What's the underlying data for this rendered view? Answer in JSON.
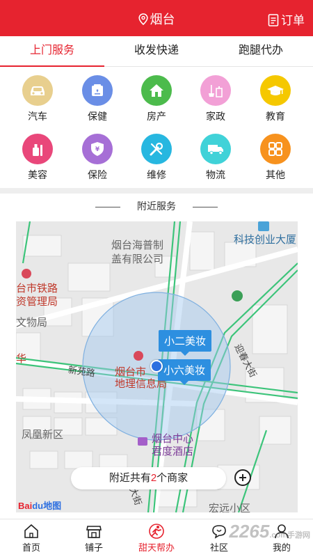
{
  "header": {
    "city": "烟台",
    "orders": "订单",
    "bg_color": "#e6232f"
  },
  "tabs": [
    {
      "label": "上门服务",
      "active": true
    },
    {
      "label": "收发快递",
      "active": false
    },
    {
      "label": "跑腿代办",
      "active": false
    }
  ],
  "categories": [
    {
      "label": "汽车",
      "icon": "car-icon",
      "color": "#e8cf8e"
    },
    {
      "label": "保健",
      "icon": "health-icon",
      "color": "#6a8ee6"
    },
    {
      "label": "房产",
      "icon": "house-icon",
      "color": "#4cbb4c"
    },
    {
      "label": "家政",
      "icon": "housekeeping-icon",
      "color": "#f2a0d6"
    },
    {
      "label": "教育",
      "icon": "graduation-cap-icon",
      "color": "#f5c800"
    },
    {
      "label": "美容",
      "icon": "beauty-icon",
      "color": "#e9477a"
    },
    {
      "label": "保险",
      "icon": "insurance-icon",
      "color": "#a66fd6"
    },
    {
      "label": "维修",
      "icon": "repair-icon",
      "color": "#27b7e0"
    },
    {
      "label": "物流",
      "icon": "truck-icon",
      "color": "#40d2d8"
    },
    {
      "label": "其他",
      "icon": "grid-icon",
      "color": "#f7921e"
    }
  ],
  "nearby": {
    "title": "附近服务"
  },
  "map": {
    "labels": {
      "l1": "烟台海普制",
      "l2": "盖有限公司",
      "l3": "科技创业大厦",
      "l4": "台市铁路",
      "l5": "资管理局",
      "l6": "文物局",
      "l7": "烟台市",
      "l8": "地理信息局",
      "l9": "新苑路",
      "l10": "凤凰新区",
      "l11": "烟台中心",
      "l12": "君度酒店",
      "l13": "迎春大街",
      "l14": "宏远小区",
      "l15": "华",
      "l16": "大街"
    },
    "pins": [
      "小二美妆",
      "小六美妆"
    ],
    "count_prefix": "附近共有",
    "count": "2",
    "count_suffix": "个商家",
    "logo_a": "Bai",
    "logo_b": "du",
    "logo_c": "地图"
  },
  "bottom_nav": [
    {
      "label": "首页",
      "icon": "home-icon",
      "active": false
    },
    {
      "label": "铺子",
      "icon": "shop-icon",
      "active": false
    },
    {
      "label": "甜天帮办",
      "icon": "runner-icon",
      "active": true
    },
    {
      "label": "社区",
      "icon": "community-icon",
      "active": false
    },
    {
      "label": "我的",
      "icon": "user-icon",
      "active": false
    }
  ],
  "watermark": {
    "main": "2265",
    "sub": ".com",
    "small": "手游网"
  }
}
